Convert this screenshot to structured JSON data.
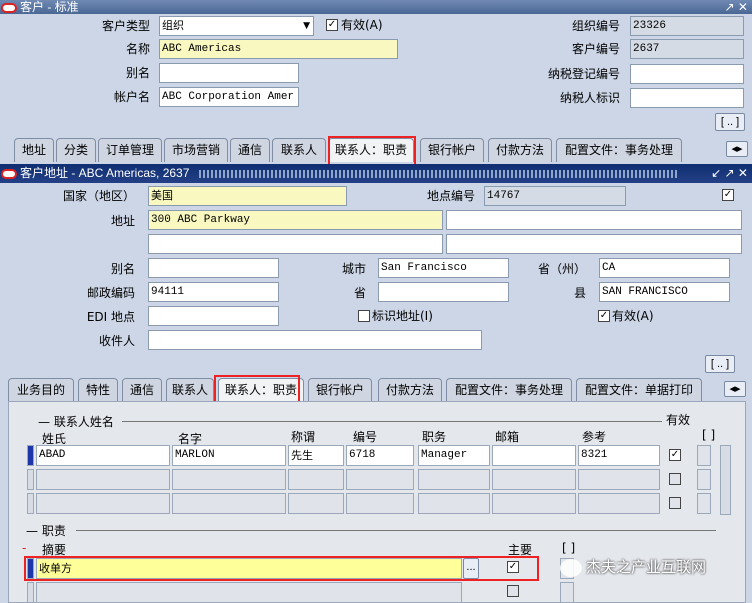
{
  "outer_window": {
    "title": "客户 - 标准",
    "customer_type_label": "客户类型",
    "customer_type_value": "组织",
    "active_label": "有效(A)",
    "name_label": "名称",
    "name_value": "ABC Americas",
    "alias_label": "别名",
    "alias_value": "",
    "account_name_label": "帐户名",
    "account_name_value": "ABC Corporation Amer",
    "org_number_label": "组织编号",
    "org_number_value": "23326",
    "customer_number_label": "客户编号",
    "customer_number_value": "2637",
    "taxpayer_reg_label": "纳税登记编号",
    "taxpayer_reg_value": "",
    "taxpayer_id_label": "纳税人标识",
    "taxpayer_id_value": "",
    "more_button": "[ .. ]",
    "tabs": [
      "地址",
      "分类",
      "订单管理",
      "市场营销",
      "通信",
      "联系人",
      "联系人：职责",
      "银行帐户",
      "付款方法",
      "配置文件：事务处理"
    ]
  },
  "address_window": {
    "title": "客户地址 - ABC Americas, 2637",
    "country_label": "国家（地区）",
    "country_value": "美国",
    "site_number_label": "地点编号",
    "site_number_value": "14767",
    "address_label": "地址",
    "address_line1": "300 ABC Parkway",
    "alias_label": "别名",
    "alias_value": "",
    "city_label": "城市",
    "city_value": "San Francisco",
    "province_label": "省（州）",
    "province_value": "CA",
    "postal_label": "邮政编码",
    "postal_value": "94111",
    "state_label": "省",
    "state_value": "",
    "county_label": "县",
    "county_value": "SAN FRANCISCO",
    "edi_label": "EDI 地点",
    "edi_value": "",
    "identifying_label": "标识地址(I)",
    "active_label": "有效(A)",
    "recipient_label": "收件人",
    "recipient_value": "",
    "more_button": "[ .. ]",
    "tabs": [
      "业务目的",
      "特性",
      "通信",
      "联系人",
      "联系人：职责",
      "银行帐户",
      "付款方法",
      "配置文件：事务处理",
      "配置文件：单据打印"
    ]
  },
  "contacts": {
    "group_label": "联系人姓名",
    "active_header": "有效",
    "bracket": "[ ]",
    "columns": [
      "姓氏",
      "名字",
      "称谓",
      "编号",
      "职务",
      "邮箱",
      "参考"
    ],
    "rows": [
      [
        "ABAD",
        "MARLON",
        "先生",
        "6718",
        "Manager",
        "",
        "8321"
      ],
      [
        "",
        "",
        "",
        "",
        "",
        "",
        ""
      ],
      [
        "",
        "",
        "",
        "",
        "",
        "",
        ""
      ]
    ]
  },
  "roles": {
    "group_label": "职责",
    "summary_header": "摘要",
    "primary_header": "主要",
    "bracket": "[ ]",
    "row1_value": "收单方",
    "lov_button": "..."
  },
  "watermark": "杰夫之产业互联网"
}
